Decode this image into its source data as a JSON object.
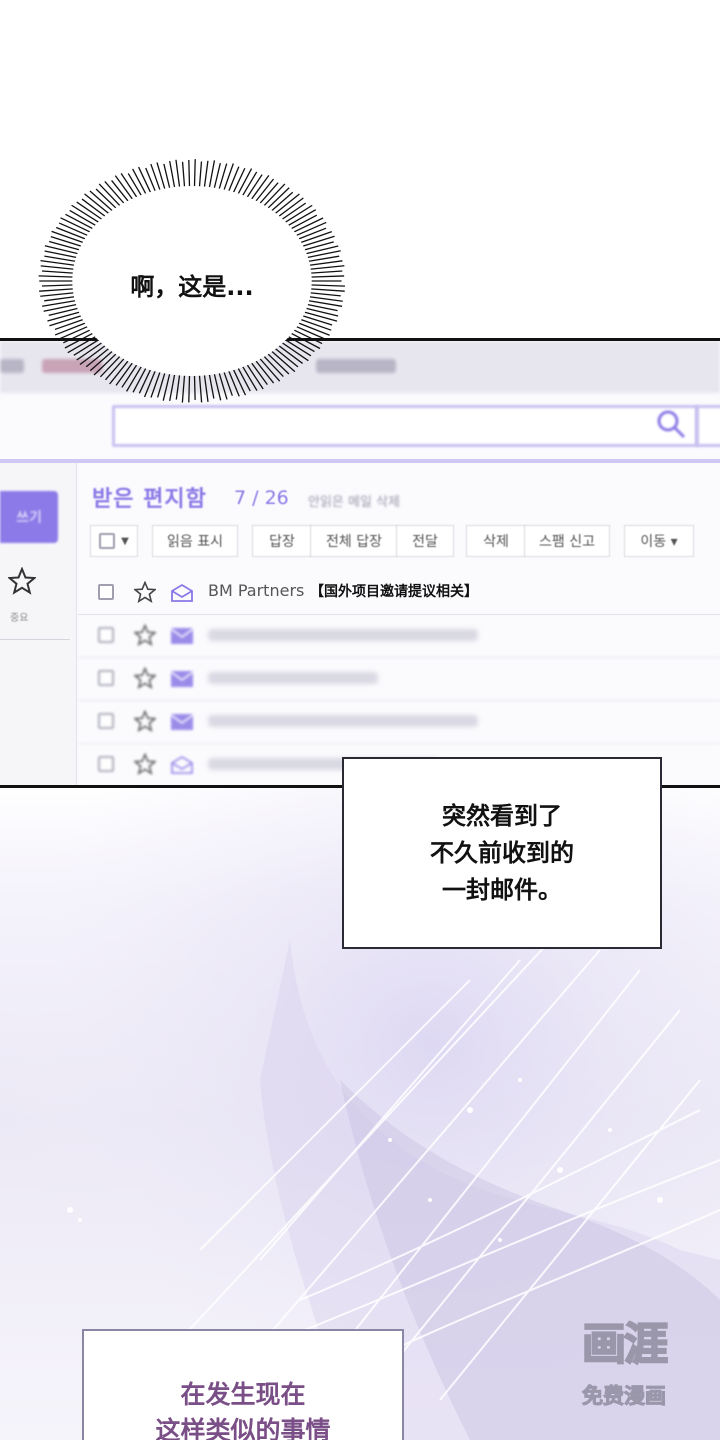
{
  "bubble": {
    "text": "啊，这是..."
  },
  "mail": {
    "title": "받은 편지함",
    "count": "7 / 26",
    "unread_label": "안읽은 메일 삭제",
    "write_button": "쓰기",
    "sidebar_star_label": "중요",
    "toolbar": [
      "읽음 표시",
      "답장",
      "전체 답장",
      "전달",
      "삭제",
      "스팸 신고",
      "이동 ▾"
    ],
    "rows": [
      {
        "sender": "BM Partners",
        "subject": "【国外项目邀请提议相关】",
        "read": true
      },
      {
        "sender": "",
        "subject": "",
        "read": false
      },
      {
        "sender": "",
        "subject": "",
        "read": false
      },
      {
        "sender": "",
        "subject": "",
        "read": false
      },
      {
        "sender": "",
        "subject": "",
        "read": true
      }
    ]
  },
  "captions": {
    "first": [
      "突然看到了",
      "不久前收到的",
      "一封邮件。"
    ],
    "second": [
      "在发生现在",
      "这样类似的事情"
    ]
  },
  "watermark": {
    "logo": "画涯",
    "sub": "免费漫画"
  },
  "colors": {
    "accent": "#8a78e6",
    "caption2_text": "#7a4e86"
  }
}
